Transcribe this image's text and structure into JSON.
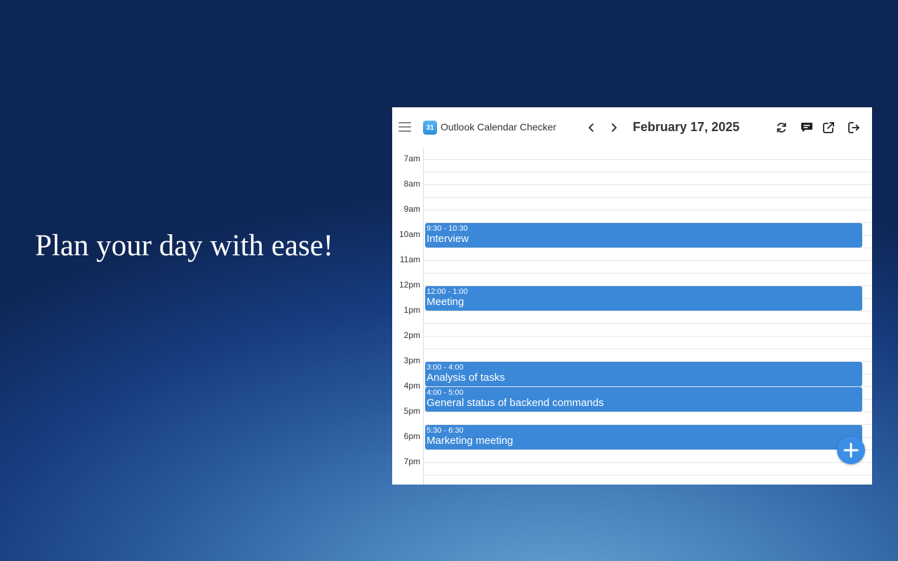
{
  "tagline": "Plan your day with ease!",
  "app": {
    "logo_text": "31",
    "title": "Outlook Calendar Checker",
    "date": "February 17, 2025"
  },
  "icons": {
    "menu": "hamburger-icon",
    "prev": "chevron-left-icon",
    "next": "chevron-right-icon",
    "refresh": "refresh-icon",
    "feedback": "feedback-icon",
    "external": "external-link-icon",
    "logout": "logout-icon",
    "add": "plus-icon"
  },
  "colors": {
    "event": "#3b88d8",
    "fab": "#3b8fe6"
  },
  "hours": [
    "7am",
    "8am",
    "9am",
    "10am",
    "11am",
    "12pm",
    "1pm",
    "2pm",
    "3pm",
    "4pm",
    "5pm",
    "6pm",
    "7pm"
  ],
  "events": [
    {
      "time": "9:30 - 10:30",
      "title": "Interview"
    },
    {
      "time": "12:00 - 1:00",
      "title": "Meeting"
    },
    {
      "time": "3:00 - 4:00",
      "title": "Analysis of tasks"
    },
    {
      "time": "4:00 - 5:00",
      "title": "General status of backend commands"
    },
    {
      "time": "5:30 - 6:30",
      "title": "Marketing meeting"
    }
  ]
}
